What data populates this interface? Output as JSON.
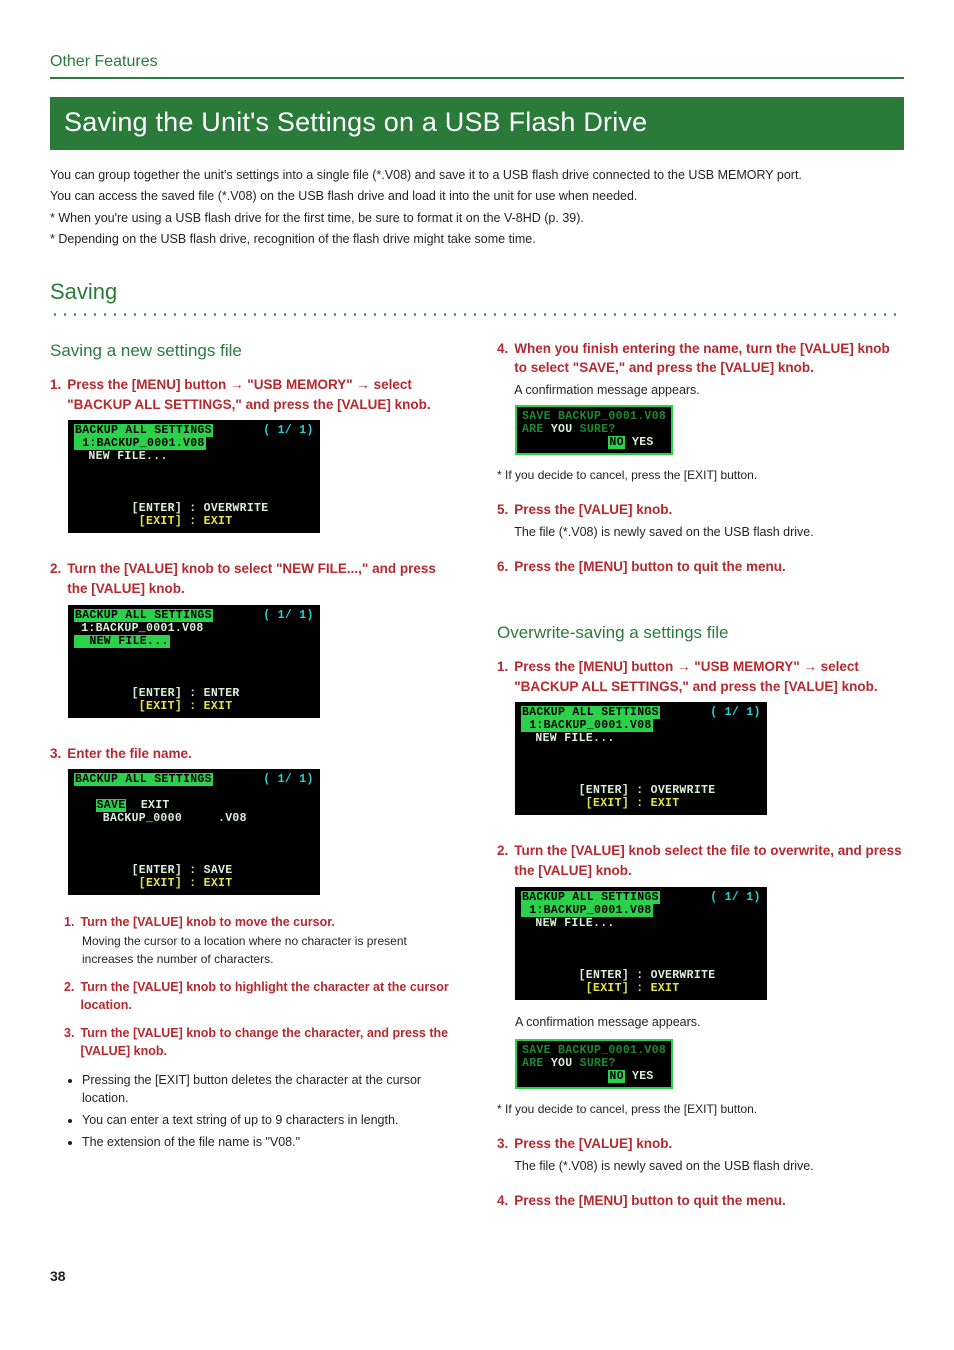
{
  "category": "Other Features",
  "title": "Saving the Unit's Settings on a USB Flash Drive",
  "intro": {
    "p1": "You can group together the unit's settings into a single file (*.V08) and save it to a USB flash drive connected to the USB MEMORY port.",
    "p2": "You can access the saved file (*.V08) on the USB flash drive and load it into the unit for use when needed.",
    "n1": "*  When you're using a USB flash drive for the first time, be sure to format it on the V-8HD (p. 39).",
    "n2": "*  Depending on the USB flash drive, recognition of the flash drive might take some time."
  },
  "section": "Saving",
  "save_new": {
    "heading": "Saving a new settings file",
    "s1": {
      "num": "1.",
      "a": "Press the [MENU] button ",
      "b": "\"USB MEMORY\" ",
      "c": "select \"BACKUP ALL SETTINGS,\" and press the [VALUE] knob."
    },
    "s2": {
      "num": "2.",
      "txt": "Turn the [VALUE] knob to select \"NEW FILE...,\" and press the [VALUE] knob."
    },
    "s3": {
      "num": "3.",
      "txt": "Enter the file name."
    },
    "sub1": {
      "num": "1.",
      "txt": "Turn the [VALUE] knob to move the cursor.",
      "desc": "Moving the cursor to a location where no character is present increases the number of characters."
    },
    "sub2": {
      "num": "2.",
      "txt": "Turn the [VALUE] knob to highlight the character at the cursor location."
    },
    "sub3": {
      "num": "3.",
      "txt": "Turn the [VALUE] knob to change the character, and press the [VALUE] knob."
    },
    "b1": "Pressing the [EXIT] button deletes the character at the cursor location.",
    "b2": "You can enter a text string of up to 9 characters in length.",
    "b3": "The extension of the file name is \"V08.\"",
    "s4": {
      "num": "4.",
      "txt": "When you finish entering the name, turn the [VALUE] knob to select \"SAVE,\" and press the [VALUE] knob.",
      "desc": "A confirmation message appears."
    },
    "cancel_note": "*  If you decide to cancel, press the [EXIT] button.",
    "s5": {
      "num": "5.",
      "txt": "Press the [VALUE] knob.",
      "desc": "The file (*.V08) is newly saved on the USB flash drive."
    },
    "s6": {
      "num": "6.",
      "txt": "Press the [MENU] button to quit the menu."
    }
  },
  "overwrite": {
    "heading": "Overwrite-saving a settings file",
    "s1": {
      "num": "1.",
      "a": "Press the [MENU] button ",
      "b": "\"USB MEMORY\" ",
      "c": "select \"BACKUP ALL SETTINGS,\" and press the [VALUE] knob."
    },
    "s2": {
      "num": "2.",
      "txt": "Turn the [VALUE] knob select the file to overwrite, and press the [VALUE] knob.",
      "desc": "A confirmation message appears."
    },
    "cancel_note": "*  If you decide to cancel, press the [EXIT] button.",
    "s3": {
      "num": "3.",
      "txt": "Press the [VALUE] knob.",
      "desc": "The file (*.V08) is newly saved on the USB flash drive."
    },
    "s4": {
      "num": "4.",
      "txt": "Press the [MENU] button to quit the menu."
    }
  },
  "lcd": {
    "bas_title": "BACKUP ALL SETTINGS",
    "page_ind": "( 1/ 1)",
    "file1": " 1:BACKUP_0001.V08",
    "newfile": "  NEW FILE...",
    "enter_overwrite": "        [ENTER] : OVERWRITE",
    "enter_enter": "        [ENTER] : ENTER",
    "enter_save": "        [ENTER] : SAVE",
    "exit_exit": "         [EXIT] : EXIT",
    "save_exit": "   SAVE  EXIT",
    "backup_0000": "    BACKUP_0000     .V08",
    "confirm_l1": "SAVE BACKUP_0001.V08",
    "confirm_l2_a": "ARE ",
    "confirm_l2_b": "YOU",
    "confirm_l2_c": " SURE?",
    "confirm_l3_no": "NO",
    "confirm_l3_yes": " YES"
  },
  "page_number": "38"
}
